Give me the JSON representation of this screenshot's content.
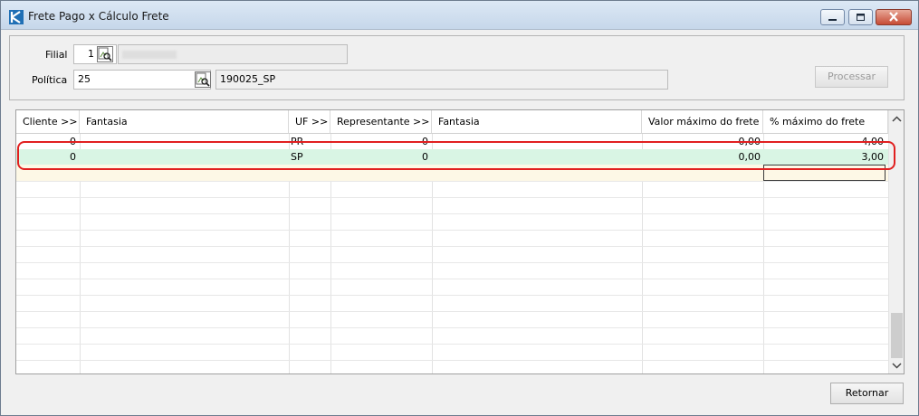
{
  "window": {
    "title": "Frete Pago x Cálculo Frete"
  },
  "filters": {
    "filial_label": "Filial",
    "filial_code": "1",
    "politica_label": "Política",
    "politica_code": "25",
    "politica_desc": "190025_SP"
  },
  "buttons": {
    "processar": "Processar",
    "retornar": "Retornar"
  },
  "grid": {
    "columns": [
      "Cliente >>",
      "Fantasia",
      "UF >>",
      "Representante >>",
      "Fantasia",
      "Valor máximo do frete",
      "% máximo do frete"
    ],
    "rows": [
      {
        "cliente": "0",
        "fantasia": "",
        "uf": "PR",
        "representante": "0",
        "fantasia_rep": "",
        "valor_max": "0,00",
        "pct_max": "4,00"
      },
      {
        "cliente": "0",
        "fantasia": "",
        "uf": "SP",
        "representante": "0",
        "fantasia_rep": "",
        "valor_max": "0,00",
        "pct_max": "3,00"
      }
    ]
  },
  "colors": {
    "selected_row": "#d9f5e4",
    "highlight_ring": "#e12020",
    "new_row": "#fdf8e6"
  },
  "icons": [
    "app-logo-icon",
    "minimize-icon",
    "maximize-icon",
    "close-icon",
    "lookup-search-icon",
    "scroll-up-icon",
    "scroll-down-icon"
  ]
}
